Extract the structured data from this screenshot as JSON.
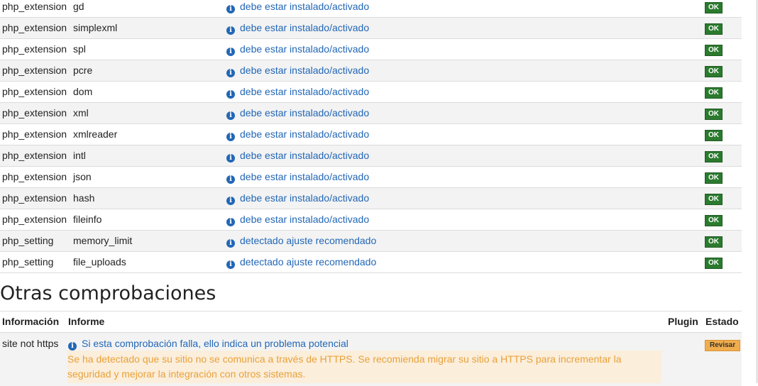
{
  "requirements": [
    {
      "type": "php_extension",
      "name": "gd",
      "info": "debe estar instalado/activado",
      "status": "OK"
    },
    {
      "type": "php_extension",
      "name": "simplexml",
      "info": "debe estar instalado/activado",
      "status": "OK"
    },
    {
      "type": "php_extension",
      "name": "spl",
      "info": "debe estar instalado/activado",
      "status": "OK"
    },
    {
      "type": "php_extension",
      "name": "pcre",
      "info": "debe estar instalado/activado",
      "status": "OK"
    },
    {
      "type": "php_extension",
      "name": "dom",
      "info": "debe estar instalado/activado",
      "status": "OK"
    },
    {
      "type": "php_extension",
      "name": "xml",
      "info": "debe estar instalado/activado",
      "status": "OK"
    },
    {
      "type": "php_extension",
      "name": "xmlreader",
      "info": "debe estar instalado/activado",
      "status": "OK"
    },
    {
      "type": "php_extension",
      "name": "intl",
      "info": "debe estar instalado/activado",
      "status": "OK"
    },
    {
      "type": "php_extension",
      "name": "json",
      "info": "debe estar instalado/activado",
      "status": "OK"
    },
    {
      "type": "php_extension",
      "name": "hash",
      "info": "debe estar instalado/activado",
      "status": "OK"
    },
    {
      "type": "php_extension",
      "name": "fileinfo",
      "info": "debe estar instalado/activado",
      "status": "OK"
    },
    {
      "type": "php_setting",
      "name": "memory_limit",
      "info": "detectado ajuste recomendado",
      "status": "OK"
    },
    {
      "type": "php_setting",
      "name": "file_uploads",
      "info": "detectado ajuste recomendado",
      "status": "OK"
    }
  ],
  "other_checks": {
    "title": "Otras comprobaciones",
    "headers": {
      "info": "Información",
      "report": "Informe",
      "plugin": "Plugin",
      "status": "Estado"
    },
    "rows": [
      {
        "info": "site not https",
        "report": "Si esta comprobación falla, ello indica un problema potencial",
        "warning": "Se ha detectado que su sitio no se comunica a través de HTTPS. Se recomienda migrar su sitio a HTTPS para incrementar la seguridad y mejorar la integración con otros sistemas.",
        "plugin": "",
        "status": "Revisar"
      }
    ]
  },
  "icons": {
    "info": "info-circle-icon"
  },
  "colors": {
    "link": "#2267b6",
    "ok": "#2b7a2e",
    "review": "#f0ad4e",
    "warning_bg": "#fbeedb",
    "warning_text": "#e8a13a"
  }
}
